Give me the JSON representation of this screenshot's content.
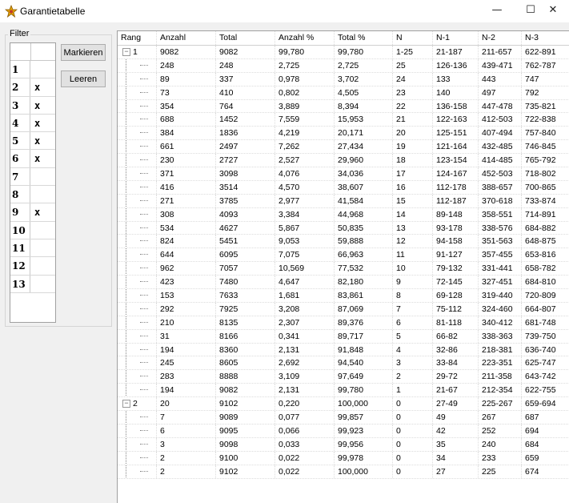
{
  "window": {
    "title": "Garantietabelle",
    "minimize": "—",
    "maximize": "☐",
    "close": "✕"
  },
  "filter": {
    "caption": "Filter",
    "rows": [
      {
        "num": "1",
        "mark": ""
      },
      {
        "num": "2",
        "mark": "x"
      },
      {
        "num": "3",
        "mark": "x"
      },
      {
        "num": "4",
        "mark": "x"
      },
      {
        "num": "5",
        "mark": "x"
      },
      {
        "num": "6",
        "mark": "x"
      },
      {
        "num": "7",
        "mark": ""
      },
      {
        "num": "8",
        "mark": ""
      },
      {
        "num": "9",
        "mark": "x"
      },
      {
        "num": "10",
        "mark": ""
      },
      {
        "num": "11",
        "mark": ""
      },
      {
        "num": "12",
        "mark": ""
      },
      {
        "num": "13",
        "mark": ""
      }
    ],
    "mark_button": "Markieren",
    "clear_button": "Leeren"
  },
  "table": {
    "columns": [
      "Rang",
      "Anzahl",
      "Total",
      "Anzahl %",
      "Total %",
      "N",
      "N-1",
      "N-2",
      "N-3"
    ],
    "rows": [
      {
        "rang": "1",
        "group": true,
        "cells": [
          "9082",
          "9082",
          "99,780",
          "99,780",
          "1-25",
          "21-187",
          "211-657",
          "622-891"
        ]
      },
      {
        "cells": [
          "248",
          "248",
          "2,725",
          "2,725",
          "25",
          "126-136",
          "439-471",
          "762-787"
        ]
      },
      {
        "cells": [
          "89",
          "337",
          "0,978",
          "3,702",
          "24",
          "133",
          "443",
          "747"
        ]
      },
      {
        "cells": [
          "73",
          "410",
          "0,802",
          "4,505",
          "23",
          "140",
          "497",
          "792"
        ]
      },
      {
        "cells": [
          "354",
          "764",
          "3,889",
          "8,394",
          "22",
          "136-158",
          "447-478",
          "735-821"
        ]
      },
      {
        "cells": [
          "688",
          "1452",
          "7,559",
          "15,953",
          "21",
          "122-163",
          "412-503",
          "722-838"
        ]
      },
      {
        "cells": [
          "384",
          "1836",
          "4,219",
          "20,171",
          "20",
          "125-151",
          "407-494",
          "757-840"
        ]
      },
      {
        "cells": [
          "661",
          "2497",
          "7,262",
          "27,434",
          "19",
          "121-164",
          "432-485",
          "746-845"
        ]
      },
      {
        "cells": [
          "230",
          "2727",
          "2,527",
          "29,960",
          "18",
          "123-154",
          "414-485",
          "765-792"
        ]
      },
      {
        "cells": [
          "371",
          "3098",
          "4,076",
          "34,036",
          "17",
          "124-167",
          "452-503",
          "718-802"
        ]
      },
      {
        "cells": [
          "416",
          "3514",
          "4,570",
          "38,607",
          "16",
          "112-178",
          "388-657",
          "700-865"
        ]
      },
      {
        "cells": [
          "271",
          "3785",
          "2,977",
          "41,584",
          "15",
          "112-187",
          "370-618",
          "733-874"
        ]
      },
      {
        "cells": [
          "308",
          "4093",
          "3,384",
          "44,968",
          "14",
          "89-148",
          "358-551",
          "714-891"
        ]
      },
      {
        "cells": [
          "534",
          "4627",
          "5,867",
          "50,835",
          "13",
          "93-178",
          "338-576",
          "684-882"
        ]
      },
      {
        "cells": [
          "824",
          "5451",
          "9,053",
          "59,888",
          "12",
          "94-158",
          "351-563",
          "648-875"
        ]
      },
      {
        "cells": [
          "644",
          "6095",
          "7,075",
          "66,963",
          "11",
          "91-127",
          "357-455",
          "653-816"
        ]
      },
      {
        "cells": [
          "962",
          "7057",
          "10,569",
          "77,532",
          "10",
          "79-132",
          "331-441",
          "658-782"
        ]
      },
      {
        "cells": [
          "423",
          "7480",
          "4,647",
          "82,180",
          "9",
          "72-145",
          "327-451",
          "684-810"
        ]
      },
      {
        "cells": [
          "153",
          "7633",
          "1,681",
          "83,861",
          "8",
          "69-128",
          "319-440",
          "720-809"
        ]
      },
      {
        "cells": [
          "292",
          "7925",
          "3,208",
          "87,069",
          "7",
          "75-112",
          "324-460",
          "664-807"
        ]
      },
      {
        "cells": [
          "210",
          "8135",
          "2,307",
          "89,376",
          "6",
          "81-118",
          "340-412",
          "681-748"
        ]
      },
      {
        "cells": [
          "31",
          "8166",
          "0,341",
          "89,717",
          "5",
          "66-82",
          "338-363",
          "739-750"
        ]
      },
      {
        "cells": [
          "194",
          "8360",
          "2,131",
          "91,848",
          "4",
          "32-86",
          "218-381",
          "636-740"
        ]
      },
      {
        "cells": [
          "245",
          "8605",
          "2,692",
          "94,540",
          "3",
          "33-84",
          "223-351",
          "625-747"
        ]
      },
      {
        "cells": [
          "283",
          "8888",
          "3,109",
          "97,649",
          "2",
          "29-72",
          "211-358",
          "643-742"
        ]
      },
      {
        "cells": [
          "194",
          "9082",
          "2,131",
          "99,780",
          "1",
          "21-67",
          "212-354",
          "622-755"
        ]
      },
      {
        "rang": "2",
        "group": true,
        "cells": [
          "20",
          "9102",
          "0,220",
          "100,000",
          "0",
          "27-49",
          "225-267",
          "659-694"
        ]
      },
      {
        "cells": [
          "7",
          "9089",
          "0,077",
          "99,857",
          "0",
          "49",
          "267",
          "687"
        ]
      },
      {
        "cells": [
          "6",
          "9095",
          "0,066",
          "99,923",
          "0",
          "42",
          "252",
          "694"
        ]
      },
      {
        "cells": [
          "3",
          "9098",
          "0,033",
          "99,956",
          "0",
          "35",
          "240",
          "684"
        ]
      },
      {
        "cells": [
          "2",
          "9100",
          "0,022",
          "99,978",
          "0",
          "34",
          "233",
          "659"
        ]
      },
      {
        "cells": [
          "2",
          "9102",
          "0,022",
          "100,000",
          "0",
          "27",
          "225",
          "674"
        ]
      }
    ]
  }
}
